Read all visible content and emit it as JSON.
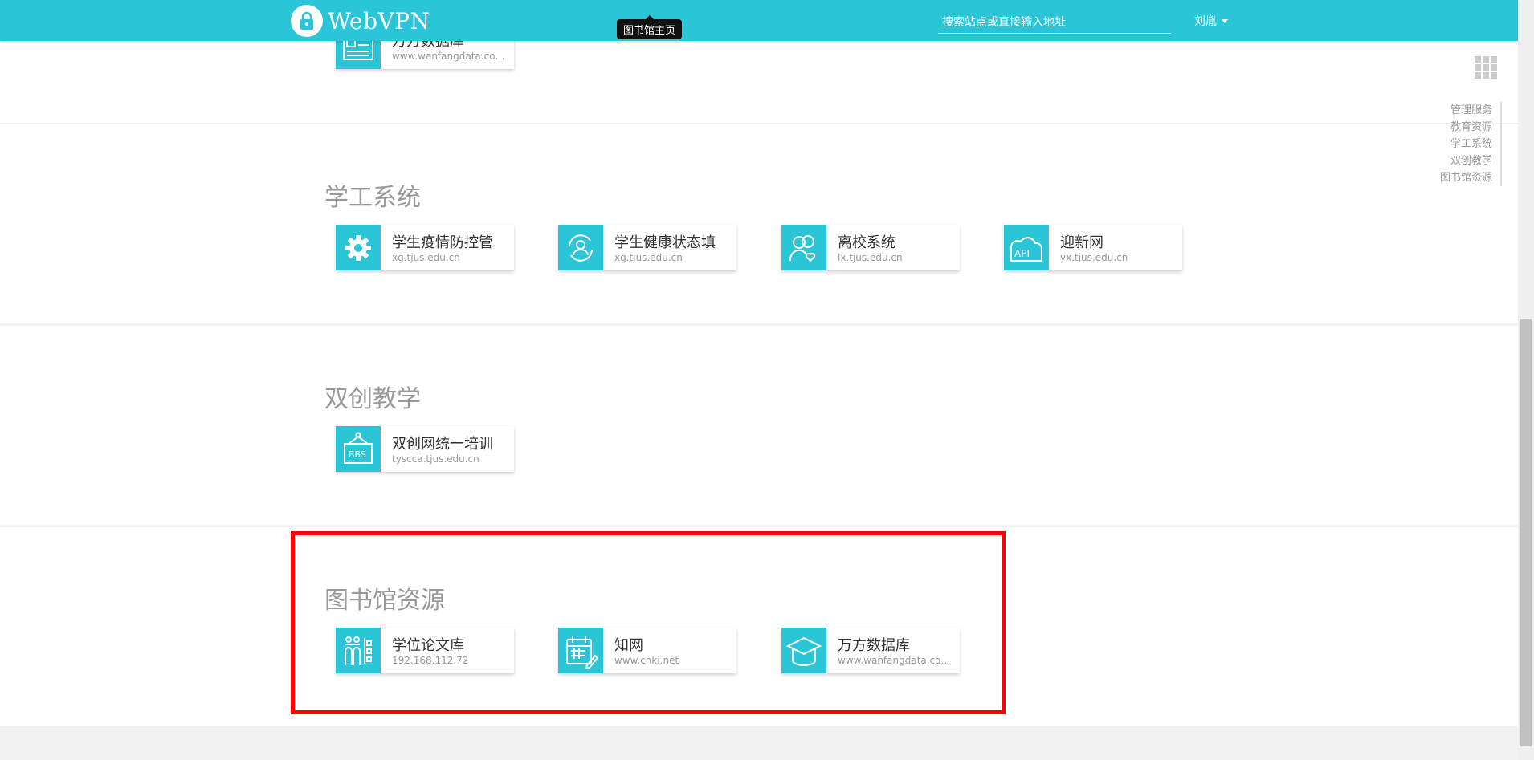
{
  "header": {
    "logo_text": "WebVPN",
    "tooltip": "图书馆主页",
    "search_placeholder": "搜索站点或直接输入地址",
    "user_name": "刘胤"
  },
  "sections": [
    {
      "items": [
        {
          "name": "万方数据库",
          "url": "www.wanfangdata.com...",
          "icon": "document-list-icon"
        }
      ]
    },
    {
      "title": "学工系统",
      "items": [
        {
          "name": "学生疫情防控管",
          "url": "xg.tjus.edu.cn",
          "icon": "gear-icon"
        },
        {
          "name": "学生健康状态填",
          "url": "xg.tjus.edu.cn",
          "icon": "user-refresh-icon"
        },
        {
          "name": "离校系统",
          "url": "lx.tjus.edu.cn",
          "icon": "users-heart-icon"
        },
        {
          "name": "迎新网",
          "url": "yx.tjus.edu.cn",
          "icon": "api-cloud-icon"
        }
      ]
    },
    {
      "title": "双创教学",
      "items": [
        {
          "name": "双创网统一培训",
          "url": "tyscca.tjus.edu.cn",
          "icon": "bbs-sign-icon"
        }
      ]
    },
    {
      "title": "图书馆资源",
      "items": [
        {
          "name": "学位论文库",
          "url": "192.168.112.72",
          "icon": "people-list-icon"
        },
        {
          "name": "知网",
          "url": "www.cnki.net",
          "icon": "calendar-edit-icon"
        },
        {
          "name": "万方数据库",
          "url": "www.wanfangdata.com...",
          "icon": "graduation-cap-icon"
        }
      ]
    }
  ],
  "side_nav": [
    "管理服务",
    "教育资源",
    "学工系统",
    "双创教学",
    "图书馆资源"
  ],
  "colors": {
    "accent": "#2bc5d8",
    "highlight": "#ff0000"
  }
}
